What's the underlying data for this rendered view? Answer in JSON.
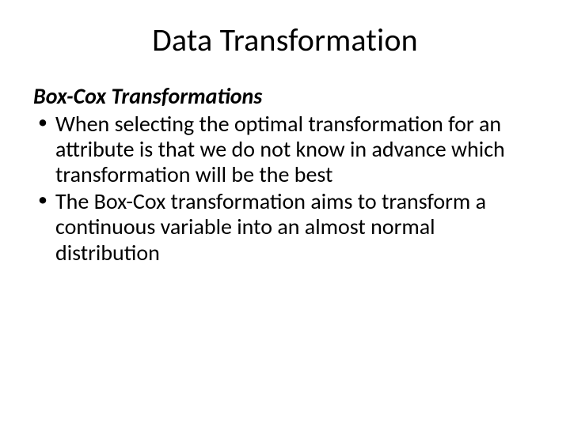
{
  "slide": {
    "title": "Data Transformation",
    "subheading": "Box-Cox Transformations",
    "bullets": [
      "When selecting the optimal transformation for an attribute is that we do not know in advance which transformation will be the best",
      "The Box-Cox transformation aims to transform a continuous variable into an almost normal distribution"
    ]
  }
}
